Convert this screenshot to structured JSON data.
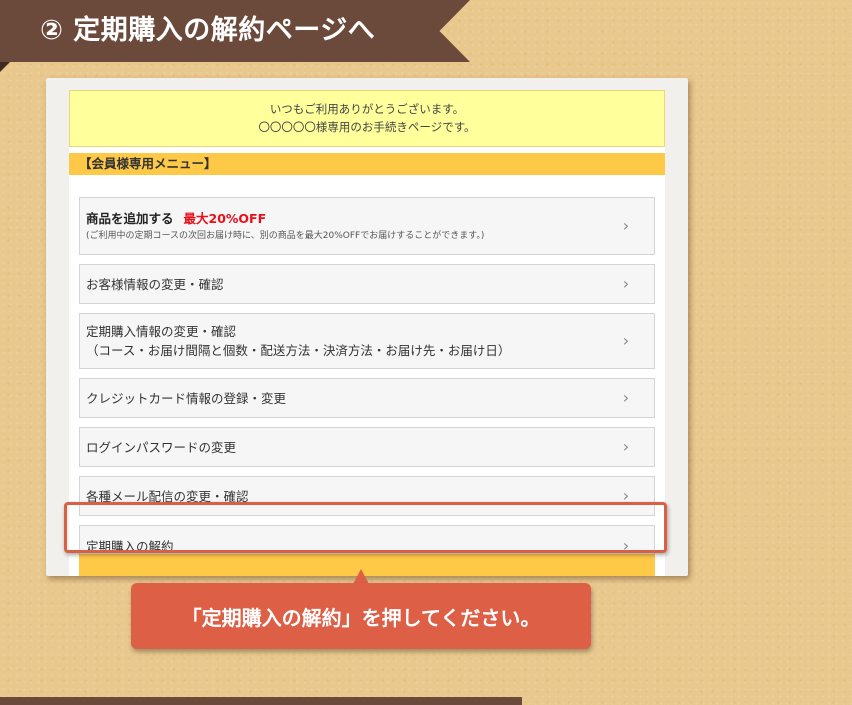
{
  "header": {
    "title": "② 定期購入の解約ページへ"
  },
  "greeting": {
    "line1": "いつもご利用ありがとうございます。",
    "line2": "〇〇〇〇〇様専用のお手続きページです。"
  },
  "menu": {
    "title": "【会員様専用メニュー】",
    "items": [
      {
        "label": "商品を追加する",
        "badge": "最大20%OFF",
        "note": "(ご利用中の定期コースの次回お届け時に、別の商品を最大20%OFFでお届けすることができます。)"
      },
      {
        "label": "お客様情報の変更・確認"
      },
      {
        "label": "定期購入情報の変更・確認",
        "sub": "（コース・お届け間隔と個数・配送方法・決済方法・お届け先・お届け日）"
      },
      {
        "label": "クレジットカード情報の登録・変更"
      },
      {
        "label": "ログインパスワードの変更"
      },
      {
        "label": "各種メール配信の変更・確認"
      },
      {
        "label": "定期購入の解約"
      }
    ],
    "chevron": "›"
  },
  "callout": {
    "text": "「定期購入の解約」を押してください。"
  },
  "colors": {
    "background": "#e9c88d",
    "ribbon": "#6b4a3c",
    "greeting_bg": "#ffff9c",
    "menu_header_bg": "#ffc948",
    "sale_text": "#e8101a",
    "highlight": "#d95f45",
    "callout_bg": "#dc5f46"
  },
  "icons": {
    "menu_item": "chevron-right-icon"
  }
}
